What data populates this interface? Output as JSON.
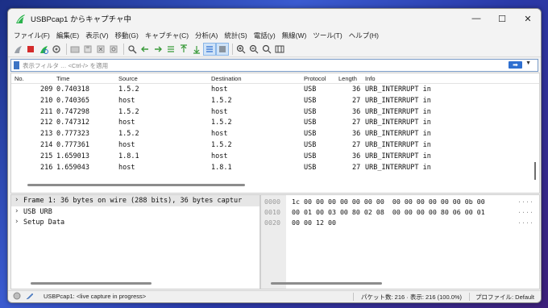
{
  "window": {
    "title": "USBPcap1 からキャプチャ中",
    "minimize_glyph": "—",
    "maximize_glyph": "☐",
    "close_glyph": "✕"
  },
  "menu": [
    "ファイル(F)",
    "編集(E)",
    "表示(V)",
    "移動(G)",
    "キャプチャ(C)",
    "分析(A)",
    "統計(S)",
    "電話(y)",
    "無線(W)",
    "ツール(T)",
    "ヘルプ(H)"
  ],
  "filter": {
    "placeholder": "表示フィルタ … <Ctrl-/> を適用",
    "apply_glyph": "➡",
    "dropdown_glyph": "▼",
    "add_glyph": "+"
  },
  "packet_list": {
    "columns": [
      "No.",
      "Time",
      "Source",
      "Destination",
      "Protocol",
      "Length",
      "Info"
    ],
    "rows": [
      {
        "no": "209",
        "time": "0.740318",
        "src": "1.5.2",
        "dst": "host",
        "proto": "USB",
        "len": "36",
        "info": "URB_INTERRUPT in"
      },
      {
        "no": "210",
        "time": "0.740365",
        "src": "host",
        "dst": "1.5.2",
        "proto": "USB",
        "len": "27",
        "info": "URB_INTERRUPT in"
      },
      {
        "no": "211",
        "time": "0.747298",
        "src": "1.5.2",
        "dst": "host",
        "proto": "USB",
        "len": "36",
        "info": "URB_INTERRUPT in"
      },
      {
        "no": "212",
        "time": "0.747312",
        "src": "host",
        "dst": "1.5.2",
        "proto": "USB",
        "len": "27",
        "info": "URB_INTERRUPT in"
      },
      {
        "no": "213",
        "time": "0.777323",
        "src": "1.5.2",
        "dst": "host",
        "proto": "USB",
        "len": "36",
        "info": "URB_INTERRUPT in"
      },
      {
        "no": "214",
        "time": "0.777361",
        "src": "host",
        "dst": "1.5.2",
        "proto": "USB",
        "len": "27",
        "info": "URB_INTERRUPT in"
      },
      {
        "no": "215",
        "time": "1.659013",
        "src": "1.8.1",
        "dst": "host",
        "proto": "USB",
        "len": "36",
        "info": "URB_INTERRUPT in"
      },
      {
        "no": "216",
        "time": "1.659043",
        "src": "host",
        "dst": "1.8.1",
        "proto": "USB",
        "len": "27",
        "info": "URB_INTERRUPT in"
      }
    ]
  },
  "details": {
    "rows": [
      {
        "chevron": "›",
        "text": "Frame 1: 36 bytes on wire (288 bits), 36 bytes captur"
      },
      {
        "chevron": "›",
        "text": "USB URB"
      },
      {
        "chevron": "›",
        "text": "Setup Data"
      }
    ]
  },
  "hex": {
    "rows": [
      {
        "offset": "0000",
        "bytes": "1c 00 00 00 00 00 00 00  00 00 00 00 00 00 0b 00",
        "ascii": "····"
      },
      {
        "offset": "0010",
        "bytes": "00 01 00 03 00 80 02 08  00 00 00 00 80 06 00 01",
        "ascii": "····"
      },
      {
        "offset": "0020",
        "bytes": "00 00 12 00",
        "ascii": "····"
      }
    ]
  },
  "status": {
    "capture": "USBPcap1: <live capture in progress>",
    "packets": "パケット数: 216 · 表示: 216 (100.0%)",
    "profile": "プロファイル: Default"
  },
  "colors": {
    "accent": "#2e6fd0",
    "selected_row": "#e6e6e6",
    "record_red": "#d42b2b",
    "shark_green": "#2bb24c"
  }
}
